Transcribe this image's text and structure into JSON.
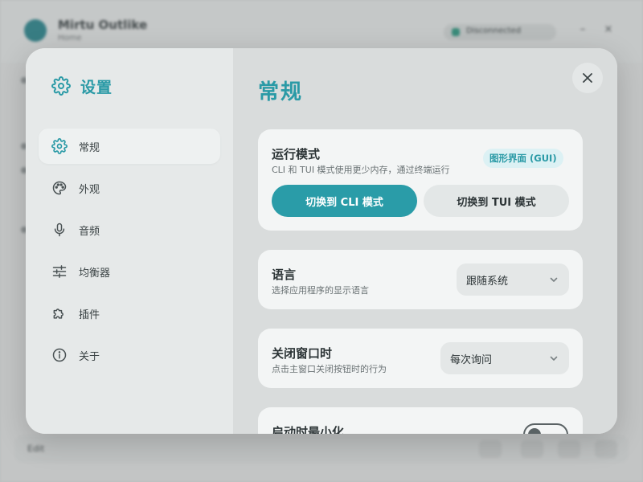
{
  "background_app": {
    "title": "Mirtu Outlike",
    "subtitle": "Home",
    "status": "Disconnected",
    "footer_label": "Edit"
  },
  "sidebar": {
    "title": "设置",
    "items": [
      {
        "label": "常规",
        "icon": "gear-icon",
        "active": true
      },
      {
        "label": "外观",
        "icon": "palette-icon",
        "active": false
      },
      {
        "label": "音频",
        "icon": "microphone-icon",
        "active": false
      },
      {
        "label": "均衡器",
        "icon": "sliders-icon",
        "active": false
      },
      {
        "label": "插件",
        "icon": "puzzle-icon",
        "active": false
      },
      {
        "label": "关于",
        "icon": "info-icon",
        "active": false
      }
    ]
  },
  "main": {
    "title": "常规",
    "run_mode": {
      "title": "运行模式",
      "description": "CLI 和 TUI 模式使用更少内存，通过终端运行",
      "badge": "图形界面 (GUI)",
      "cli_button": "切换到 CLI 模式",
      "tui_button": "切换到 TUI 模式"
    },
    "language": {
      "title": "语言",
      "description": "选择应用程序的显示语言",
      "value": "跟随系统"
    },
    "close_window": {
      "title": "关闭窗口时",
      "description": "点击主窗口关闭按钮时的行为",
      "value": "每次询问"
    },
    "start_minimized": {
      "title": "启动时最小化",
      "enabled": false
    }
  },
  "colors": {
    "accent": "#2a9ca8",
    "accent_light": "#dcf1f4",
    "text": "#2c3436",
    "muted_text": "#6a7274"
  }
}
